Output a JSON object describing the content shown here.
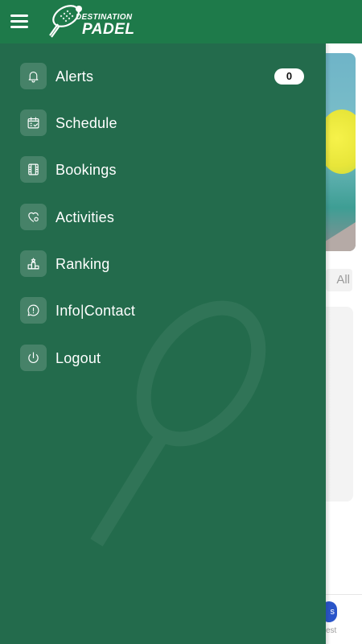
{
  "app": {
    "logo_top": "DESTINATION",
    "logo_bottom": "PADEL",
    "brand_color": "#1e7a4a",
    "drawer_color": "#236b4c"
  },
  "menu": {
    "items": [
      {
        "label": "Alerts",
        "icon": "bell-icon",
        "badge": "0"
      },
      {
        "label": "Schedule",
        "icon": "calendar-check-icon"
      },
      {
        "label": "Bookings",
        "icon": "film-strip-icon"
      },
      {
        "label": "Activities",
        "icon": "heart-gear-icon"
      },
      {
        "label": "Ranking",
        "icon": "podium-icon"
      },
      {
        "label": "Info|Contact",
        "icon": "chat-info-icon"
      },
      {
        "label": "Logout",
        "icon": "power-icon"
      }
    ]
  },
  "behind": {
    "filter_all": "All",
    "nav_partial": "est",
    "fab_partial": "s"
  }
}
